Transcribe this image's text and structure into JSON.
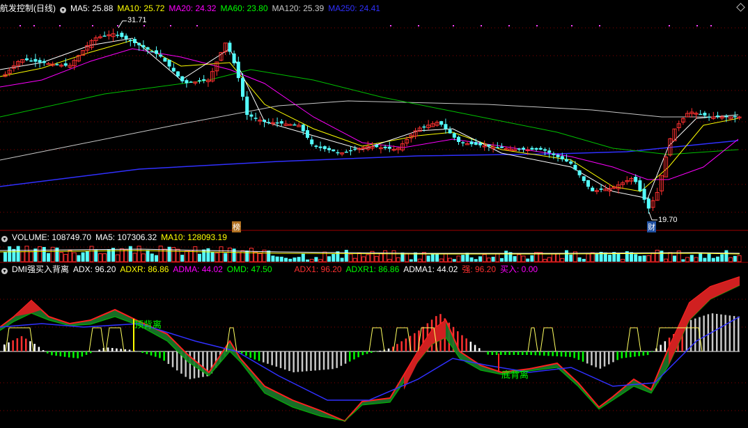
{
  "price_panel": {
    "title": "航发控制(日线)",
    "ma": [
      {
        "label": "MA5: 25.88",
        "color": "#ffffff"
      },
      {
        "label": "MA10: 25.72",
        "color": "#ffff00"
      },
      {
        "label": "MA20: 24.32",
        "color": "#ff00ff"
      },
      {
        "label": "MA60: 23.80",
        "color": "#00ff00"
      },
      {
        "label": "MA120: 25.39",
        "color": "#c8c8c8"
      },
      {
        "label": "MA250: 24.41",
        "color": "#3030ff"
      }
    ],
    "high_label": "31.71",
    "low_label": "19.70",
    "marker_bang": "榜",
    "marker_cai": "财"
  },
  "volume_panel": {
    "label_volume": "VOLUME: 108749.70",
    "label_ma5": "MA5: 107306.32",
    "label_ma10": "MA10: 128093.19"
  },
  "dmi_panel": {
    "title": "DMI强买入背离",
    "items": [
      {
        "label": "ADX: 96.20",
        "color": "#ffffff"
      },
      {
        "label": "ADXR: 86.86",
        "color": "#ffff00"
      },
      {
        "label": "ADMA: 44.02",
        "color": "#ff00ff"
      },
      {
        "label": "OMD: 47.50",
        "color": "#00ff00"
      }
    ],
    "items2": [
      {
        "label": "ADX1: 96.20",
        "color": "#ff3030"
      },
      {
        "label": "ADXR1: 86.86",
        "color": "#00ff00"
      },
      {
        "label": "ADMA1: 44.02",
        "color": "#ffffff"
      },
      {
        "label": "强: 96.20",
        "color": "#ff3030"
      },
      {
        "label": "买入: 0.00",
        "color": "#ff00ff"
      }
    ],
    "top_divergence": "顶背离",
    "bottom_divergence": "底背离"
  },
  "colors": {
    "up": "#ff3030",
    "down": "#54ffff",
    "grid": "#8b0000",
    "axis": "#a00000"
  },
  "chart_data": {
    "type": "candlestick",
    "series": [
      {
        "name": "MA5",
        "values": [
          25.88
        ]
      },
      {
        "name": "MA10",
        "values": [
          25.72
        ]
      },
      {
        "name": "MA20",
        "values": [
          24.32
        ]
      },
      {
        "name": "MA60",
        "values": [
          23.8
        ]
      },
      {
        "name": "MA120",
        "values": [
          25.39
        ]
      },
      {
        "name": "MA250",
        "values": [
          24.41
        ]
      }
    ],
    "annotations": [
      "31.71",
      "19.70"
    ],
    "volume": {
      "VOLUME": 108749.7,
      "MA5": 107306.32,
      "MA10": 128093.19
    },
    "indicator": {
      "ADX": 96.2,
      "ADXR": 86.86,
      "ADMA": 44.02,
      "OMD": 47.5
    }
  }
}
